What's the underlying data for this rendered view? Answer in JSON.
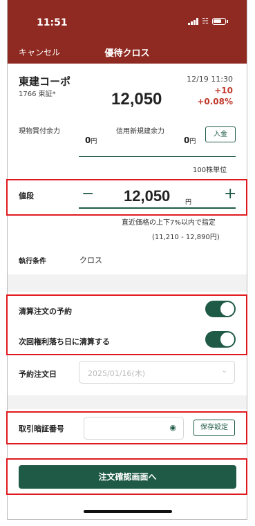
{
  "status": {
    "time": "11:51"
  },
  "header": {
    "cancel_label": "キャンセル",
    "title": "優待クロス"
  },
  "stock": {
    "name": "東建コーポ",
    "code": "1766 東証*",
    "datetime": "12/19 11:30",
    "change": "+10",
    "change_pct": "+0.08%",
    "price": "12,050"
  },
  "funds": {
    "cash_label": "現物買付余力",
    "cash_value": "0",
    "margin_label": "信用新規建余力",
    "margin_value": "0",
    "unit_yen": "円",
    "deposit_label": "入金"
  },
  "unit_note": "100株単位",
  "order_price": {
    "label": "値段",
    "minus_symbol": "−",
    "plus_symbol": "+",
    "value": "12,050",
    "unit": "円",
    "note_line1": "直近価格の上下7%以内で指定",
    "note_line2": "(11,210 - 12,890円)"
  },
  "execution": {
    "label": "執行条件",
    "value": "クロス"
  },
  "settlement": {
    "reserve_label": "清算注文の予約",
    "next_day_label": "次回権利落ち日に清算する",
    "reserve_on": true,
    "next_day_on": true
  },
  "reserve_date": {
    "label": "予約注文日",
    "value": "2025/01/16(木)"
  },
  "password": {
    "label": "取引暗証番号",
    "value": "",
    "save_label": "保存設定"
  },
  "submit": {
    "label": "注文確認画面へ"
  },
  "colors": {
    "header": "#8f2a22",
    "accent": "#1e5a45",
    "negative": "#c0392b",
    "highlight": "#e0191e"
  }
}
